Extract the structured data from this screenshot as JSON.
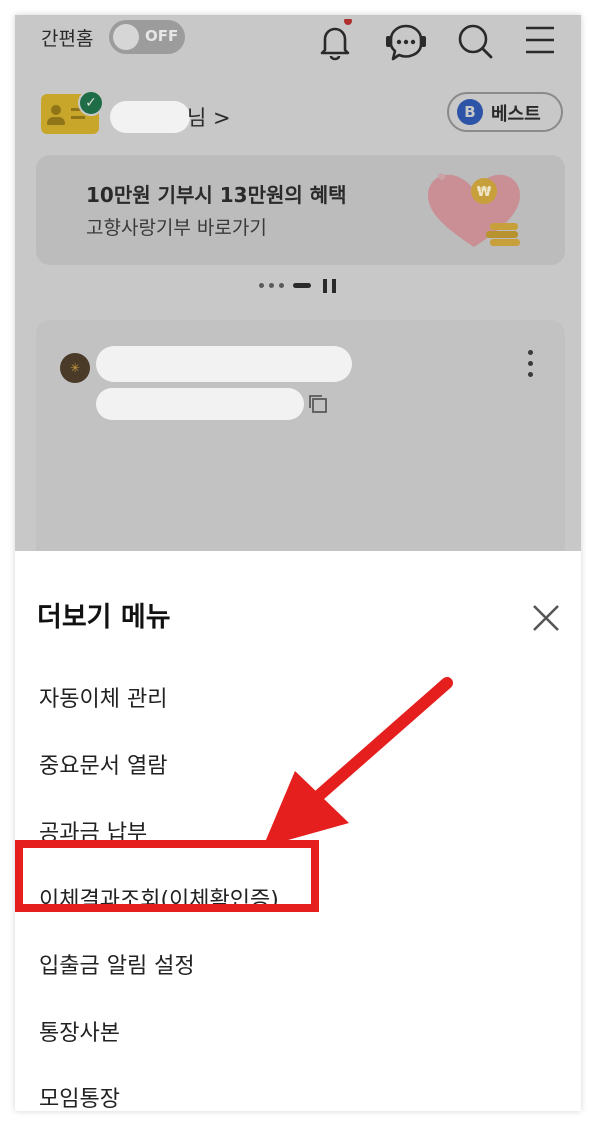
{
  "header": {
    "simple_home_label": "간편홈",
    "toggle_state": "OFF"
  },
  "user": {
    "name_suffix": "님 >",
    "grade_badge_letter": "B",
    "grade_label": "베스트"
  },
  "banner": {
    "title": "10만원 기부시 13만원의 혜택",
    "subtitle": "고향사랑기부 바로가기"
  },
  "sheet": {
    "title": "더보기 메뉴",
    "items": [
      "자동이체 관리",
      "중요문서 열람",
      "공과금 납부",
      "이체결과조회(이체확인증)",
      "입출금 알림 설정",
      "통장사본",
      "모임통장"
    ]
  },
  "colors": {
    "highlight": "#e51e1e",
    "dim_overlay": "#c8c8c8"
  },
  "icons": [
    "bell-icon",
    "chatbot-icon",
    "search-icon",
    "menu-icon",
    "close-icon",
    "copy-icon",
    "more-icon",
    "pause-icon"
  ]
}
